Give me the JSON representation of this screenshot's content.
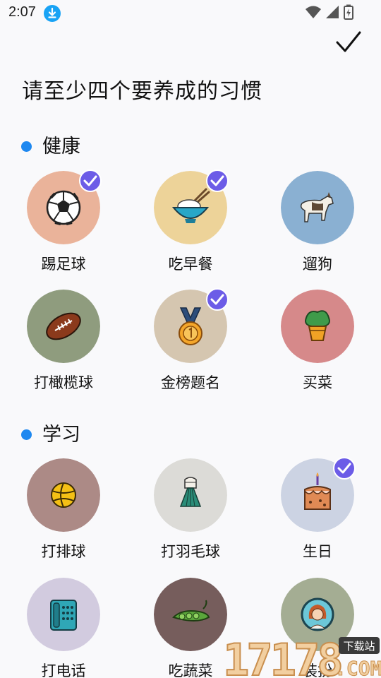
{
  "status_bar": {
    "time": "2:07"
  },
  "header": {
    "title": "请至少四个要养成的习惯"
  },
  "sections": [
    {
      "title": "健康",
      "habits": [
        {
          "label": "踢足球",
          "selected": true,
          "bg": "#eab39a",
          "icon": "soccer-ball-icon"
        },
        {
          "label": "吃早餐",
          "selected": true,
          "bg": "#edd399",
          "icon": "rice-bowl-icon"
        },
        {
          "label": "遛狗",
          "selected": false,
          "bg": "#8ab0d2",
          "icon": "dog-icon"
        },
        {
          "label": "打橄榄球",
          "selected": false,
          "bg": "#8f9c7e",
          "icon": "rugby-ball-icon"
        },
        {
          "label": "金榜题名",
          "selected": true,
          "bg": "#d5c6b0",
          "icon": "medal-icon"
        },
        {
          "label": "买菜",
          "selected": false,
          "bg": "#d6898a",
          "icon": "potted-vegetable-icon"
        }
      ]
    },
    {
      "title": "学习",
      "habits": [
        {
          "label": "打排球",
          "selected": false,
          "bg": "#ac8a86",
          "icon": "volleyball-icon"
        },
        {
          "label": "打羽毛球",
          "selected": false,
          "bg": "#dcdbd7",
          "icon": "shuttlecock-icon"
        },
        {
          "label": "生日",
          "selected": true,
          "bg": "#ccd3e3",
          "icon": "birthday-cake-icon"
        },
        {
          "label": "打电话",
          "selected": false,
          "bg": "#d2cbdf",
          "icon": "telephone-icon"
        },
        {
          "label": "吃蔬菜",
          "selected": false,
          "bg": "#765d5c",
          "icon": "pea-pod-icon"
        },
        {
          "label": "装扮",
          "selected": false,
          "bg": "#a4ad93",
          "icon": "mirror-portrait-icon"
        }
      ]
    }
  ],
  "watermark": {
    "text": "17178",
    "domain": ".COM",
    "tag": "下载站"
  },
  "colors": {
    "accent": "#6c5ce7",
    "section_dot": "#1e88f0",
    "background": "#f9f9fb"
  }
}
